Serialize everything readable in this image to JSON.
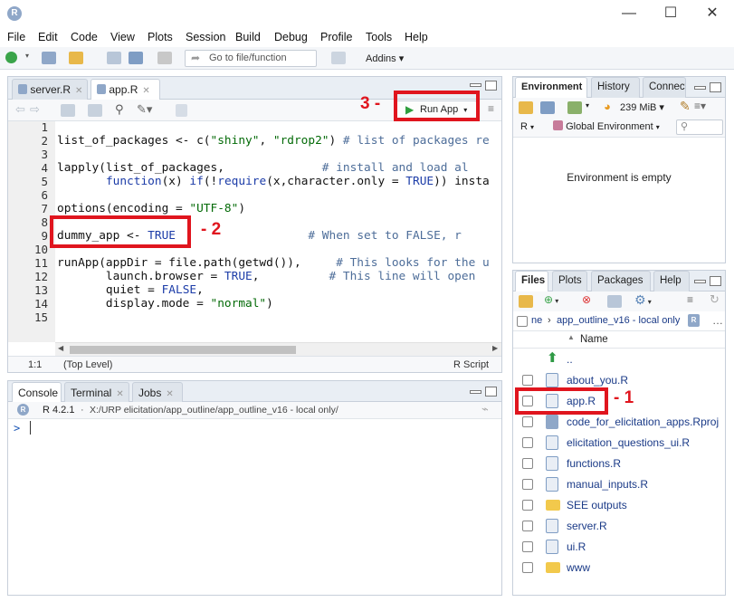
{
  "window": {
    "minimize": "—",
    "maximize": "☐",
    "close": "✕"
  },
  "menu": [
    "File",
    "Edit",
    "Code",
    "View",
    "Plots",
    "Session",
    "Build",
    "Debug",
    "Profile",
    "Tools",
    "Help"
  ],
  "toolbar": {
    "goto_placeholder": "Go to file/function",
    "addins": "Addins"
  },
  "editor": {
    "tabs": [
      {
        "label": "server.R"
      },
      {
        "label": "app.R"
      }
    ],
    "run_button": "Run App",
    "line_numbers": [
      "1",
      "2",
      "3",
      "4",
      "5",
      "6",
      "7",
      "8",
      "9",
      "10",
      "11",
      "12",
      "13",
      "14",
      "15"
    ],
    "status": {
      "position": "1:1",
      "scope": "(Top Level)",
      "filetype": "R Script"
    }
  },
  "annotations": {
    "label1": "- 1",
    "label2": "- 2",
    "label3": "3 -"
  },
  "console": {
    "tabs": [
      {
        "label": "Console"
      },
      {
        "label": "Terminal"
      },
      {
        "label": "Jobs"
      }
    ],
    "version": "R 4.2.1",
    "path": "X:/URP elicitation/app_outline/app_outline_v16 - local only/",
    "prompt": ">"
  },
  "environment": {
    "tabs": [
      "Environment",
      "History",
      "Connections"
    ],
    "memory": "239 MiB",
    "lang": "R",
    "scope": "Global Environment",
    "empty_msg": "Environment is empty"
  },
  "files": {
    "tabs": [
      "Files",
      "Plots",
      "Packages",
      "Help"
    ],
    "breadcrumb_ne": "ne",
    "breadcrumb_path": "app_outline_v16 - local only",
    "column_name": "Name",
    "parent": "..",
    "items": [
      {
        "name": "about_you.R",
        "type": "r"
      },
      {
        "name": "app.R",
        "type": "r"
      },
      {
        "name": "code_for_elicitation_apps.Rproj",
        "type": "rproj"
      },
      {
        "name": "elicitation_questions_ui.R",
        "type": "r"
      },
      {
        "name": "functions.R",
        "type": "r"
      },
      {
        "name": "manual_inputs.R",
        "type": "r"
      },
      {
        "name": "SEE outputs",
        "type": "folder"
      },
      {
        "name": "server.R",
        "type": "r"
      },
      {
        "name": "ui.R",
        "type": "r"
      },
      {
        "name": "www",
        "type": "folder"
      }
    ]
  },
  "colors": {
    "accent_red": "#e0151e",
    "run_green": "#2e9e3e",
    "folder_yellow": "#f2c94c"
  }
}
